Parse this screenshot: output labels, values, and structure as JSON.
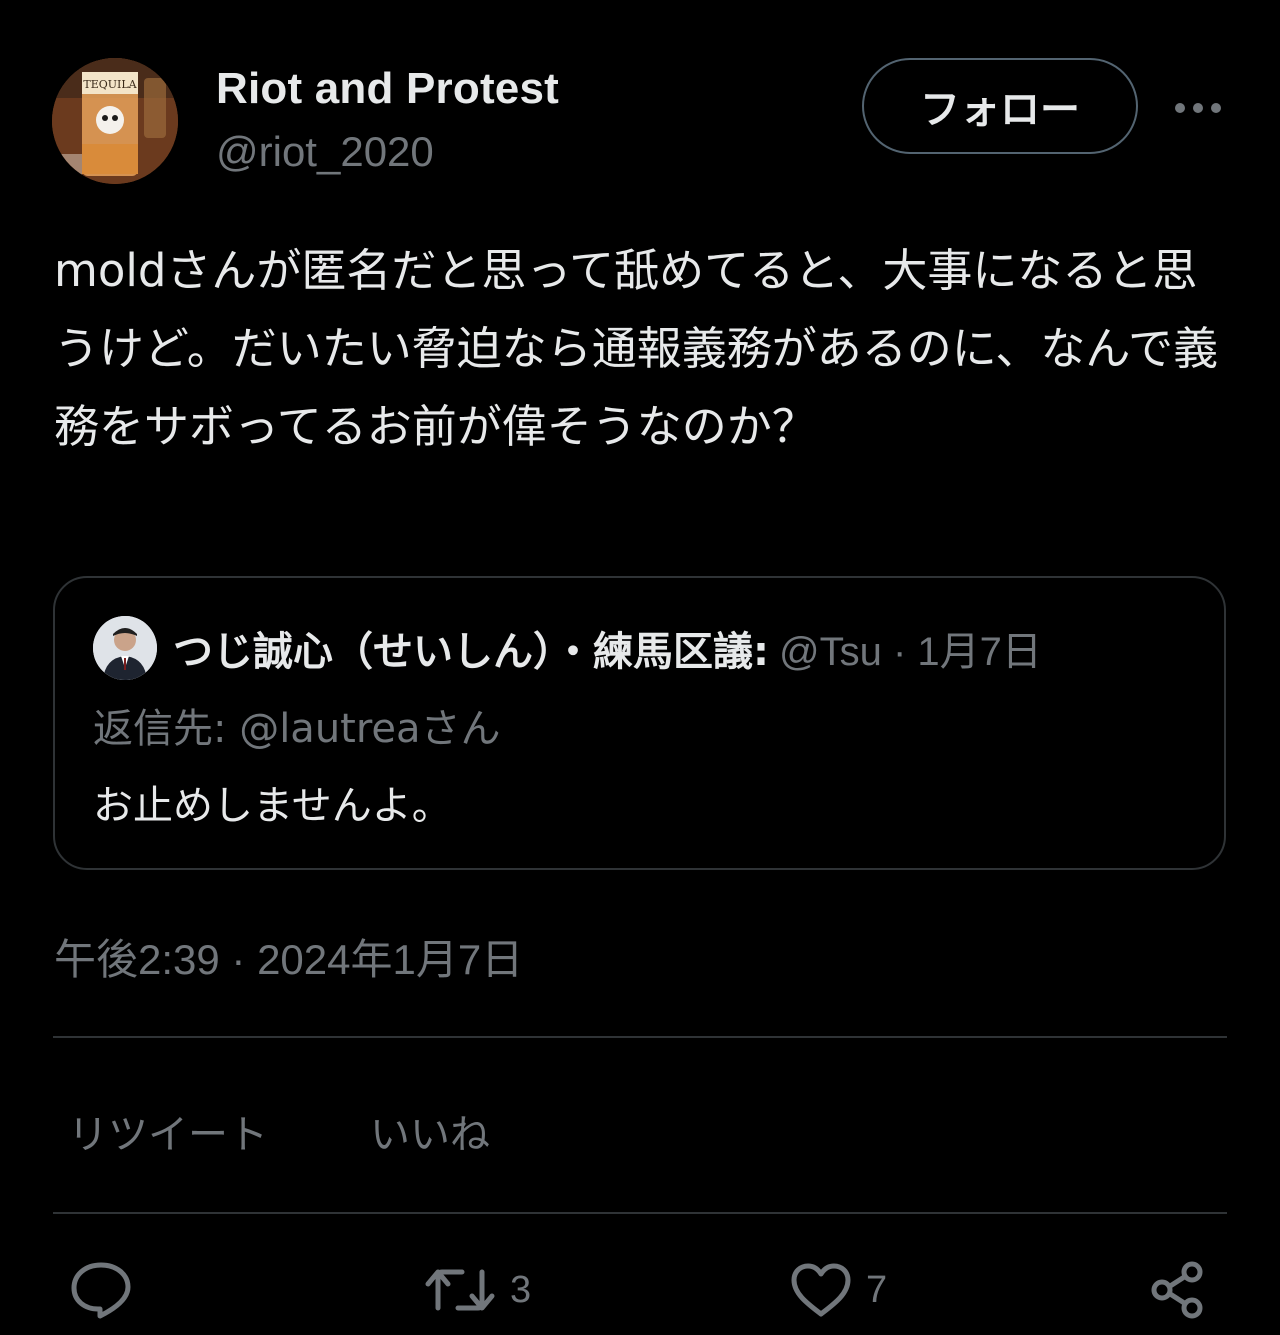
{
  "author": {
    "display_name": "Riot and Protest",
    "handle": "@riot_2020",
    "avatar_icon": "avatar-glass-photo"
  },
  "follow_label": "フォロー",
  "more_icon": "more-dots-icon",
  "tweet": {
    "text": "moldさんが匿名だと思って舐めてると、大事になると思うけど。だいたい脅迫なら通報義務があるのに、なんで義務をサボってるお前が偉そうなのか？"
  },
  "quote": {
    "display_name": "つじ誠心（せいしん）・練馬区議:",
    "meta": "@Tsu · 1月7日",
    "reply_to": "返信先: @lautreaさん",
    "text": "お止めしませんよ。"
  },
  "timestamp": "午後2:39 · 2024年1月7日",
  "stats": {
    "retweets_label": "リツイート",
    "likes_label": "いいね"
  },
  "actions": {
    "reply_icon": "reply-icon",
    "retweet_icon": "retweet-icon",
    "retweet_count": "3",
    "like_icon": "heart-icon",
    "like_count": "7",
    "share_icon": "share-icon"
  },
  "colors": {
    "background": "#000000",
    "primary_text": "#e7e9ea",
    "secondary_text": "#71767b",
    "border": "#2f3336"
  }
}
